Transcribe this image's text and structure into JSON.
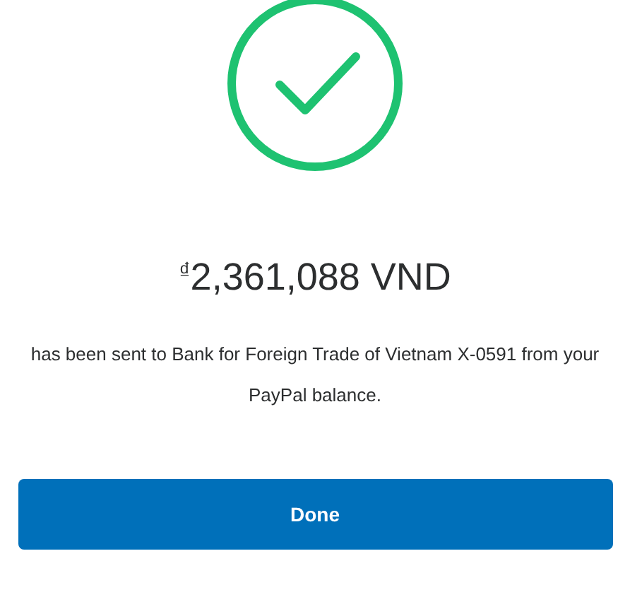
{
  "amount": "$^{₫}$2,361,088 VND",
  "message": "has been sent to Bank for Foreign Trade of Vietnam X-0591 from your PayPal balance.",
  "button": "Done"
}
